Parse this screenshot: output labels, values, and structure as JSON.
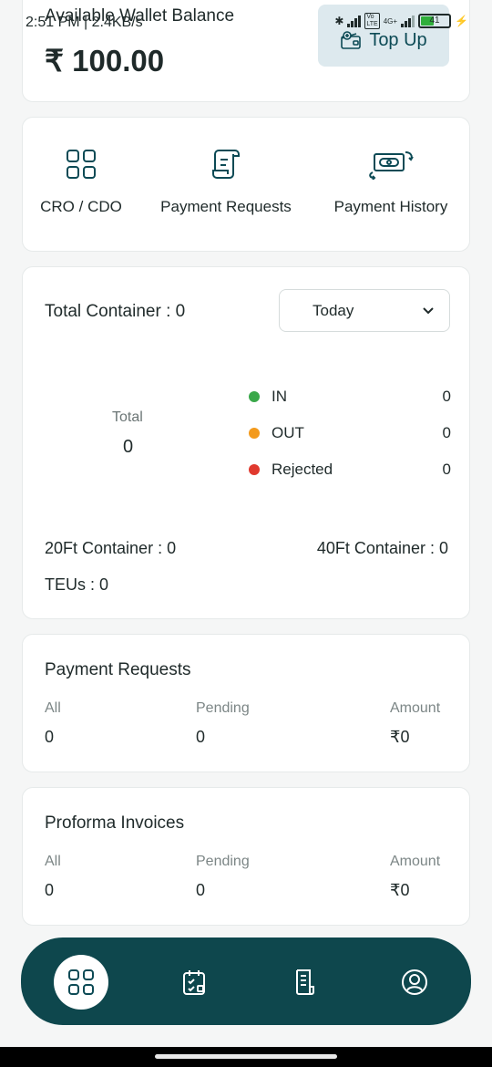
{
  "status_bar": {
    "time": "2:51 PM | 2.4KB/s",
    "network": "4G+",
    "battery": "41"
  },
  "wallet": {
    "label": "Available Wallet Balance",
    "amount": "₹ 100.00",
    "top_up_label": "Top Up"
  },
  "actions": [
    {
      "label": "CRO / CDO",
      "icon": "grid-icon"
    },
    {
      "label": "Payment Requests",
      "icon": "receipt-icon"
    },
    {
      "label": "Payment History",
      "icon": "money-exchange-icon"
    }
  ],
  "containers": {
    "title": "Total Container : 0",
    "filter": "Today",
    "total_label": "Total",
    "total_value": "0",
    "legend": [
      {
        "label": "IN",
        "value": "0",
        "color": "#3aa84a"
      },
      {
        "label": "OUT",
        "value": "0",
        "color": "#f39a1c"
      },
      {
        "label": "Rejected",
        "value": "0",
        "color": "#e0392e"
      }
    ],
    "ft20": "20Ft Container : 0",
    "ft40": "40Ft Container : 0",
    "teus": "TEUs : 0"
  },
  "payment_requests": {
    "title": "Payment Requests",
    "columns": [
      {
        "header": "All",
        "value": "0"
      },
      {
        "header": "Pending",
        "value": "0"
      },
      {
        "header": "Amount",
        "value": "₹0"
      }
    ]
  },
  "proforma_invoices": {
    "title": "Proforma Invoices",
    "columns": [
      {
        "header": "All",
        "value": "0"
      },
      {
        "header": "Pending",
        "value": "0"
      },
      {
        "header": "Amount",
        "value": "₹0"
      }
    ]
  },
  "nav": {
    "items": [
      "grid-icon",
      "calendar-check-icon",
      "invoice-icon",
      "profile-icon"
    ],
    "active": 0,
    "colors": {
      "bar": "#0e474d",
      "accent": "#0c4a55"
    }
  }
}
